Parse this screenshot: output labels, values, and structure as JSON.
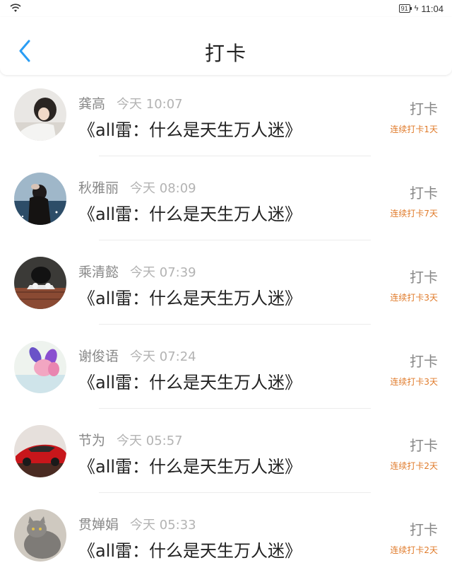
{
  "status": {
    "battery": "91",
    "time": "11:04"
  },
  "header": {
    "title": "打卡"
  },
  "colors": {
    "accent": "#2a9df4",
    "streak": "#e07b2b"
  },
  "entries": [
    {
      "name": "龚高",
      "time": "今天 10:07",
      "content": "《all雷：什么是天生万人迷》",
      "action": "打卡",
      "streak": "连续打卡1天"
    },
    {
      "name": "秋雅丽",
      "time": "今天 08:09",
      "content": "《all雷：什么是天生万人迷》",
      "action": "打卡",
      "streak": "连续打卡7天"
    },
    {
      "name": "乘清懿",
      "time": "今天 07:39",
      "content": "《all雷：什么是天生万人迷》",
      "action": "打卡",
      "streak": "连续打卡3天"
    },
    {
      "name": "谢俊语",
      "time": "今天 07:24",
      "content": "《all雷：什么是天生万人迷》",
      "action": "打卡",
      "streak": "连续打卡3天"
    },
    {
      "name": "节为",
      "time": "今天 05:57",
      "content": "《all雷：什么是天生万人迷》",
      "action": "打卡",
      "streak": "连续打卡2天"
    },
    {
      "name": "贯婵娟",
      "time": "今天 05:33",
      "content": "《all雷：什么是天生万人迷》",
      "action": "打卡",
      "streak": "连续打卡2天"
    }
  ]
}
